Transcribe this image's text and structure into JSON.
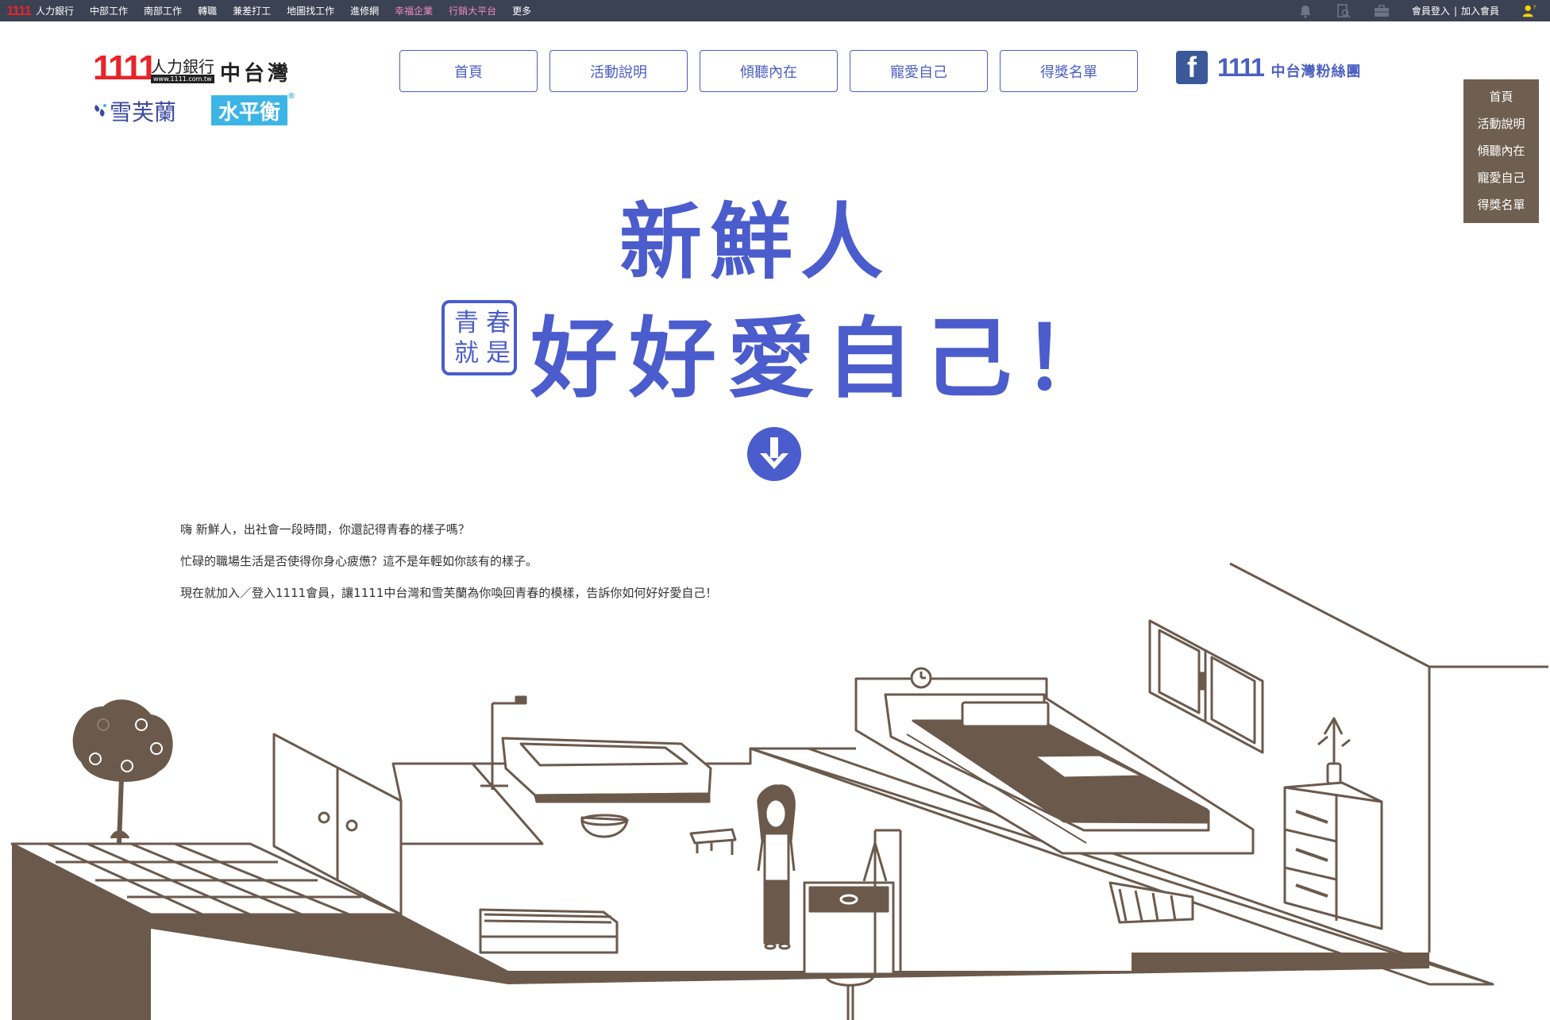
{
  "topbar": {
    "brand": "1111",
    "nav": [
      {
        "label": "人力銀行"
      },
      {
        "label": "中部工作"
      },
      {
        "label": "南部工作"
      },
      {
        "label": "轉職"
      },
      {
        "label": "兼差打工"
      },
      {
        "label": "地圖找工作"
      },
      {
        "label": "進修網"
      },
      {
        "label": "幸福企業",
        "accent": true
      },
      {
        "label": "行銷大平台",
        "accent": true
      },
      {
        "label": "更多"
      }
    ],
    "icons": [
      "bell-icon",
      "search-doc-icon",
      "briefcase-icon"
    ],
    "login": "會員登入",
    "separator": "|",
    "join": "加入會員",
    "user_icon": "user-help-icon"
  },
  "logo": {
    "number": "1111",
    "bank": "人力銀行",
    "url": "www.1111.com.tw",
    "region": "中台灣",
    "sponsor1": "雪芙蘭",
    "sponsor2": "水平衡",
    "sponsor2_mark": "®"
  },
  "main_nav": [
    {
      "label": "首頁"
    },
    {
      "label": "活動說明"
    },
    {
      "label": "傾聽內在"
    },
    {
      "label": "寵愛自己"
    },
    {
      "label": "得獎名單"
    }
  ],
  "facebook": {
    "number": "1111",
    "name": "中台灣粉絲團"
  },
  "side_nav": [
    {
      "label": "首頁"
    },
    {
      "label": "活動說明"
    },
    {
      "label": "傾聽內在"
    },
    {
      "label": "寵愛自己"
    },
    {
      "label": "得獎名單"
    }
  ],
  "hero": {
    "line1": "新鮮人",
    "seal": [
      "青",
      "春",
      "就",
      "是"
    ],
    "line2": "好好愛自己！"
  },
  "intro": [
    "嗨 新鮮人，出社會一段時間，你還記得青春的樣子嗎？",
    "忙碌的職場生活是否使得你身心疲憊？這不是年輕如你該有的樣子。",
    "現在就加入／登入1111會員，讓1111中台灣和雪芙蘭為你喚回青春的模樣，告訴你如何好好愛自己！"
  ],
  "colors": {
    "topbar": "#3b4253",
    "brand_red": "#e8242a",
    "accent_blue": "#4b5ccc",
    "side_nav": "#6e5f50",
    "illustration": "#6b5a4c",
    "facebook": "#3b5998"
  }
}
